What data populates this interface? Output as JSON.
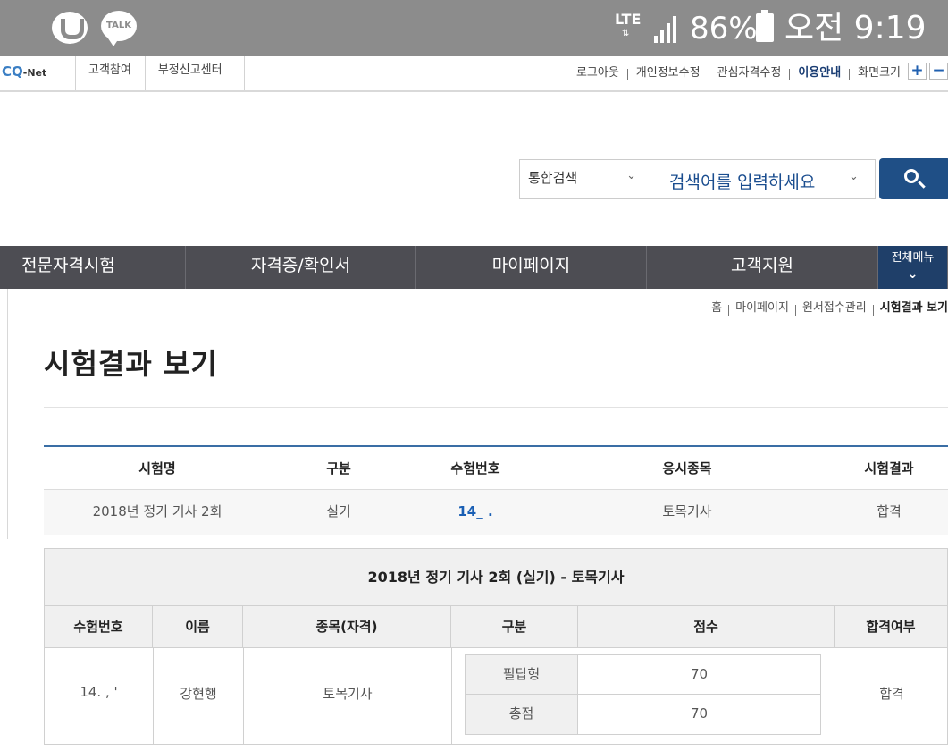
{
  "status_bar": {
    "talk_label": "TALK",
    "network": "LTE",
    "battery": "86%",
    "time": "오전 9:19"
  },
  "util_bar": {
    "logo_main": "CQ",
    "logo_sub": "-Net",
    "left_links": [
      "고객참여",
      "부정신고센터"
    ],
    "right_links": [
      "로그아웃",
      "개인정보수정",
      "관심자격수정",
      "이용안내",
      "화면크기"
    ],
    "zoom_in": "+",
    "zoom_out": "−"
  },
  "search": {
    "category": "통합검색",
    "placeholder": "검색어를 입력하세요"
  },
  "main_nav": {
    "items": [
      "전문자격시험",
      "자격증/확인서",
      "마이페이지",
      "고객지원"
    ],
    "all_menu": "전체메뉴"
  },
  "breadcrumb": [
    "홈",
    "마이페이지",
    "원서접수관리",
    "시험결과 보기"
  ],
  "page_title": "시험결과 보기",
  "results_table": {
    "headers": [
      "시험명",
      "구분",
      "수험번호",
      "응시종목",
      "시험결과"
    ],
    "rows": [
      {
        "exam": "2018년 정기 기사 2회",
        "type": "실기",
        "number": "14_ . ",
        "subject": "토목기사",
        "result": "합격"
      }
    ]
  },
  "detail": {
    "caption": "2018년 정기 기사 2회 (실기) - 토목기사",
    "headers": [
      "수험번호",
      "이름",
      "종목(자격)",
      "구분",
      "점수",
      "합격여부"
    ],
    "number": "14. , ' ",
    "name": "강현행",
    "subject": "토목기사",
    "scores": [
      {
        "type": "필답형",
        "score": "70"
      },
      {
        "type": "총점",
        "score": "70"
      }
    ],
    "pass": "합격"
  }
}
